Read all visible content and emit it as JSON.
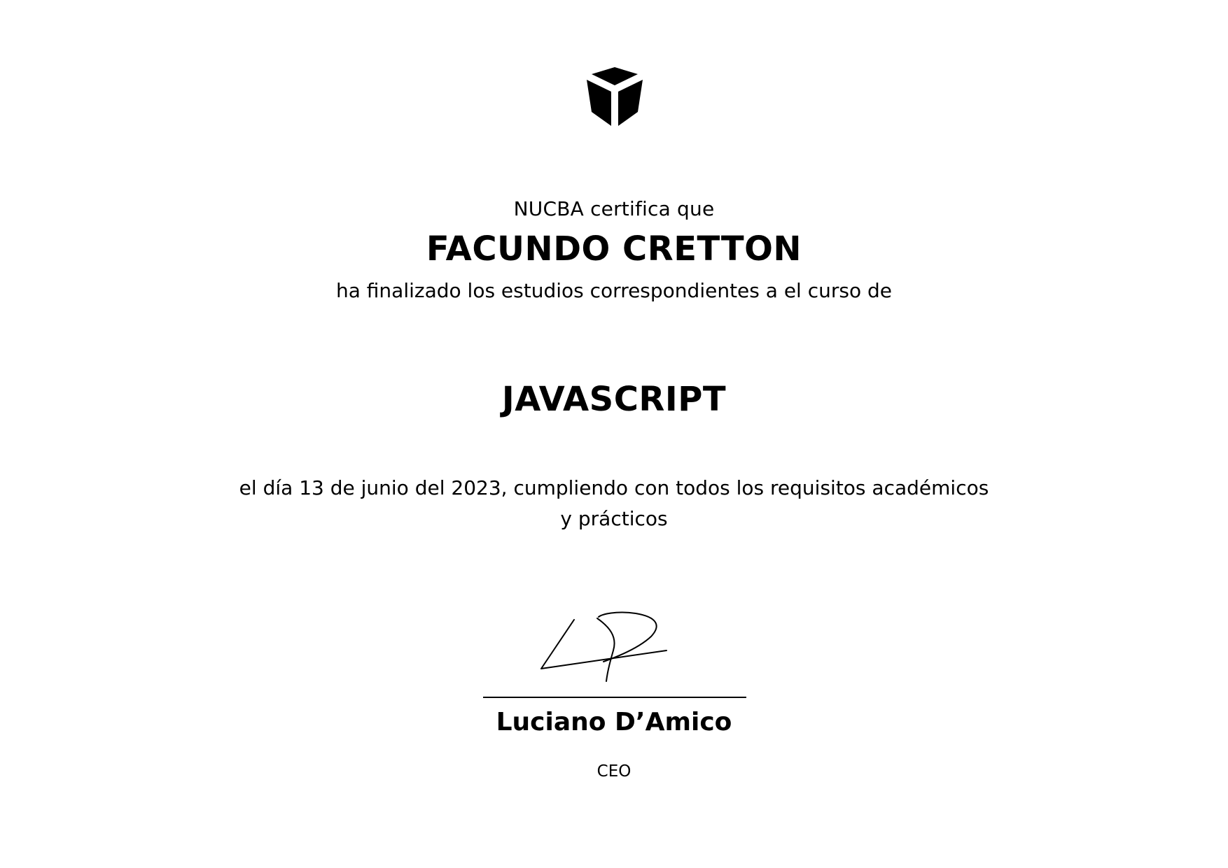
{
  "brand": {
    "logo_icon": "cube-logo-icon"
  },
  "certificate": {
    "intro": "NUCBA certifica que",
    "student_name": "FACUNDO CRETTON",
    "finished_text": "ha finalizado los estudios correspondientes a el curso de",
    "course_name": "JAVASCRIPT",
    "completion_line_1": "el día 13 de junio del 2023, cumpliendo con todos los requisitos académicos",
    "completion_line_2": "y prácticos"
  },
  "signatory": {
    "name": "Luciano D’Amico",
    "role": "CEO",
    "signature_icon": "handwritten-signature"
  }
}
